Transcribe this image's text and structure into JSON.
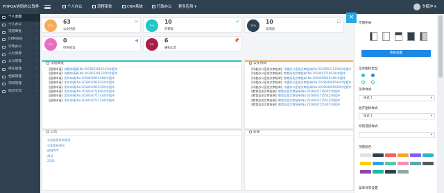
{
  "brand": "PHPOA协同办公软件",
  "topnav": [
    "个人办公",
    "流程审批",
    "CRM系统",
    "行政办公",
    "更多应用"
  ],
  "user": "令狐冲",
  "sidebar": [
    "个人桌面",
    "个人办公",
    "流程审批",
    "CRM系统",
    "行政办公",
    "人力资源",
    "公文管理",
    "用车管理",
    "档案管理",
    "项目管理",
    "知识交流"
  ],
  "stats": [
    {
      "num": "63",
      "label": "公文待阅",
      "ring": "63%",
      "ring_color": "#f8ac59",
      "icon_color": "#f8ac59"
    },
    {
      "num": "10",
      "label": "待审批",
      "ring": "10%",
      "ring_color": "#23c6c8",
      "icon_color": "#23c6c8"
    },
    {
      "num": "10",
      "label": "短消息",
      "ring": "10%",
      "ring_color": "#2f4050",
      "icon_color": "#888888"
    },
    {
      "num": "0",
      "label": "待参会议",
      "ring": "0%",
      "ring_color": "#e96dbf",
      "icon_color": "#e96dbf"
    },
    {
      "num": "6",
      "label": "通知公告",
      "ring": "6%",
      "ring_color": "#ab1e4a",
      "icon_color": "#ed5565"
    }
  ],
  "panels": {
    "approval": {
      "title": "流程审批",
      "rows": [
        {
          "tag": "【报销申请】",
          "link": "休假申请表(No:2018033012541)令狐冲"
        },
        {
          "tag": "【报销申请】",
          "link": "休假申请表(No:2018033013290)令狐冲"
        },
        {
          "tag": "【报销申请】",
          "link": "用车申请(No:2018030910448)令狐冲"
        },
        {
          "tag": "【报销申请】",
          "link": "用车申请(No:2018030910422)令狐冲"
        },
        {
          "tag": "【报销申请】",
          "link": "用车申请(No:2018030910350)令狐冲"
        },
        {
          "tag": "【报销申请】",
          "link": "用车申请(No:2018030718062)令狐冲"
        },
        {
          "tag": "【报销申请】",
          "link": "用车申请(No:2018030717434)令狐冲"
        },
        {
          "tag": "【报销申请】",
          "link": "用车申请(No:2018030717234)令狐冲"
        }
      ]
    },
    "docs": {
      "title": "公文待阅",
      "rows": [
        {
          "tag": "【市委办公室发文审批单】",
          "link": "市委办公室发文审批单(No:2018052113184)令狐冲"
        },
        {
          "tag": "【市委办公室发文审批单】",
          "link": "教育局发文审批单(No:2018051718034)令狐冲"
        },
        {
          "tag": "【市委办公室发文审批单】",
          "link": "教育局发文审批单(No:2018050618340)令狐冲"
        },
        {
          "tag": "【市委办公室发文审批单】",
          "link": "市委办公室发文审批单(No:2018040916440)令狐冲"
        },
        {
          "tag": "【市委办公室发文审批单】",
          "link": "市委办公室发文审批单(No:2018040916400)令狐冲"
        },
        {
          "tag": "【教育局发文审批单】",
          "link": "教育局发文审批单(No:2018032716005)令狐冲"
        },
        {
          "tag": "【教育局发文审批单】",
          "link": "教育局发文审批单(No:2018032715542)令狐冲"
        },
        {
          "tag": "【教育局发文审批单】",
          "link": "教育局发文审批单(No:2018032715432)令狐冲"
        },
        {
          "tag": "【教育局发文审批单】",
          "link": "教育局发文审批单(No:2018032515345)令狐冲"
        }
      ]
    },
    "notice": {
      "title": "公告",
      "links": [
        "公告信息发布测试",
        "公告发布测试",
        "gdgfhdf",
        "测试",
        "2333"
      ]
    },
    "news": {
      "title": "新闻"
    }
  },
  "overlay": {
    "layout_title": "页面布局",
    "theme_button": "系统设置",
    "menu_style_title": "菜单图标类型",
    "menu_style_label": "菜单样式",
    "menu_style_value": "样式 1",
    "expand_title": "展开图标样式",
    "expand_value": "样式 1",
    "submenu_title": "导航链接样式",
    "colors_title": "顶部颜色",
    "menu_bg_title": "菜单背景设置",
    "swatches": [
      "#e0e0e0",
      "#2f4050",
      "#f65f5f",
      "#f5a623",
      "#7d5fff",
      "#2ab7ca",
      "#ffcc00",
      "#3b9dd8",
      "#57c89c",
      "#f78fb3",
      "#60a3bc",
      "#5a5a5a",
      "#8e44ad",
      "#1abc9c",
      "#2c3e50",
      "#95a5a6"
    ]
  }
}
